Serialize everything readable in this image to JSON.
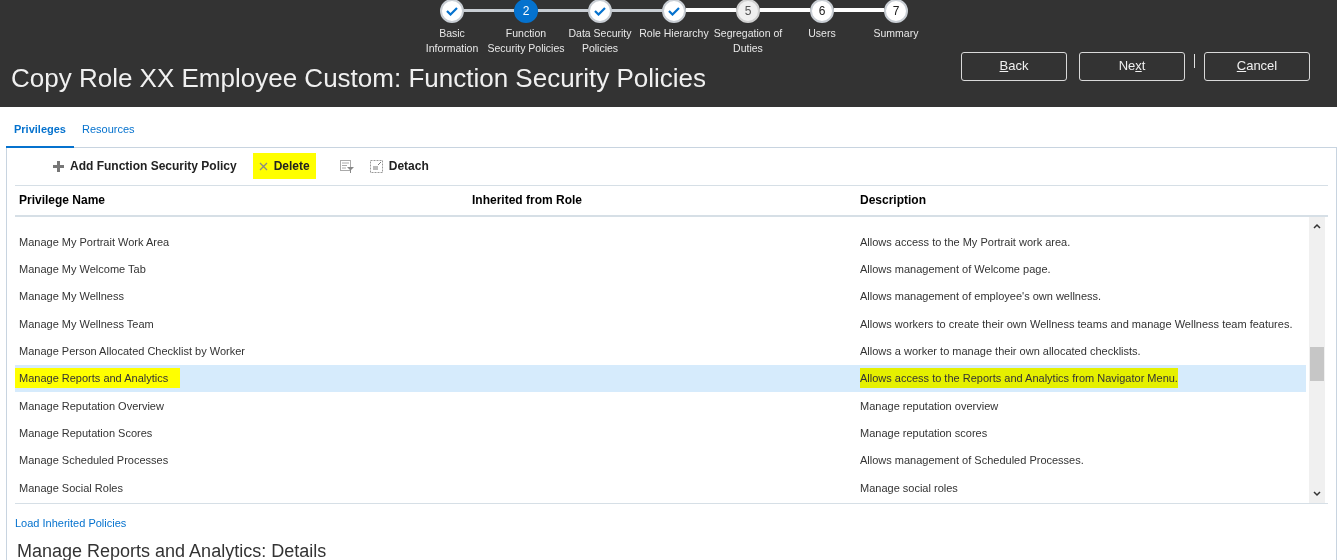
{
  "train": [
    {
      "label": "Basic Information",
      "completed": true,
      "selected": false,
      "disabled": false
    },
    {
      "number": "2",
      "label": "Function Security Policies",
      "completed": false,
      "selected": true,
      "disabled": false
    },
    {
      "label": "Data Security Policies",
      "completed": true,
      "selected": false,
      "disabled": false
    },
    {
      "label": "Role Hierarchy",
      "completed": true,
      "selected": false,
      "disabled": false
    },
    {
      "number": "5",
      "label": "Segregation of Duties",
      "completed": false,
      "selected": false,
      "disabled": true
    },
    {
      "number": "6",
      "label": "Users",
      "completed": false,
      "selected": false,
      "disabled": false
    },
    {
      "number": "7",
      "label": "Summary",
      "completed": false,
      "selected": false,
      "disabled": false
    }
  ],
  "title": "Copy Role XX Employee Custom: Function Security Policies",
  "buttons": [
    {
      "label": "Back"
    },
    {
      "label": "Next"
    },
    {
      "label": "Cancel"
    }
  ],
  "tabs": [
    {
      "label": "Privileges",
      "selected": true
    },
    {
      "label": "Resources",
      "selected": false
    }
  ],
  "toolbar": [
    {
      "kind": "add",
      "label": "Add Function Security Policy",
      "highlighted": false
    },
    {
      "kind": "delete",
      "label": "Delete",
      "highlighted": true
    },
    {
      "kind": "filter"
    },
    {
      "kind": "detach",
      "label": "Detach",
      "highlighted": false
    }
  ],
  "table": {
    "columns": [
      "Privilege Name",
      "Inherited from Role",
      "Description"
    ],
    "rows": [
      {
        "name": "Manage My Portrait Work Area",
        "description": "Allows access to the My Portrait work area.",
        "selected": false,
        "highlighted": false
      },
      {
        "name": "Manage My Welcome Tab",
        "description": "Allows management of Welcome page.",
        "selected": false,
        "highlighted": false
      },
      {
        "name": "Manage My Wellness",
        "description": "Allows management of employee's own wellness.",
        "selected": false,
        "highlighted": false
      },
      {
        "name": "Manage My Wellness Team",
        "description": "Allows workers to create their own Wellness teams and manage Wellness team features.",
        "selected": false,
        "highlighted": false
      },
      {
        "name": "Manage Person Allocated Checklist by Worker",
        "description": "Allows a worker to manage their own allocated checklists.",
        "selected": false,
        "highlighted": false
      },
      {
        "name": "Manage Reports and Analytics",
        "description": "Allows access to the Reports and Analytics from Navigator Menu.",
        "selected": true,
        "highlighted": true
      },
      {
        "name": "Manage Reputation Overview",
        "description": "Manage reputation overview",
        "selected": false,
        "highlighted": false
      },
      {
        "name": "Manage Reputation Scores",
        "description": "Manage reputation scores",
        "selected": false,
        "highlighted": false
      },
      {
        "name": "Manage Scheduled Processes",
        "description": "Allows management of Scheduled Processes.",
        "selected": false,
        "highlighted": false
      },
      {
        "name": "Manage Social Roles",
        "description": "Manage social roles",
        "selected": false,
        "highlighted": false
      }
    ]
  },
  "load_link": "Load Inherited Policies",
  "details_heading": "Manage Reports and Analytics: Details"
}
